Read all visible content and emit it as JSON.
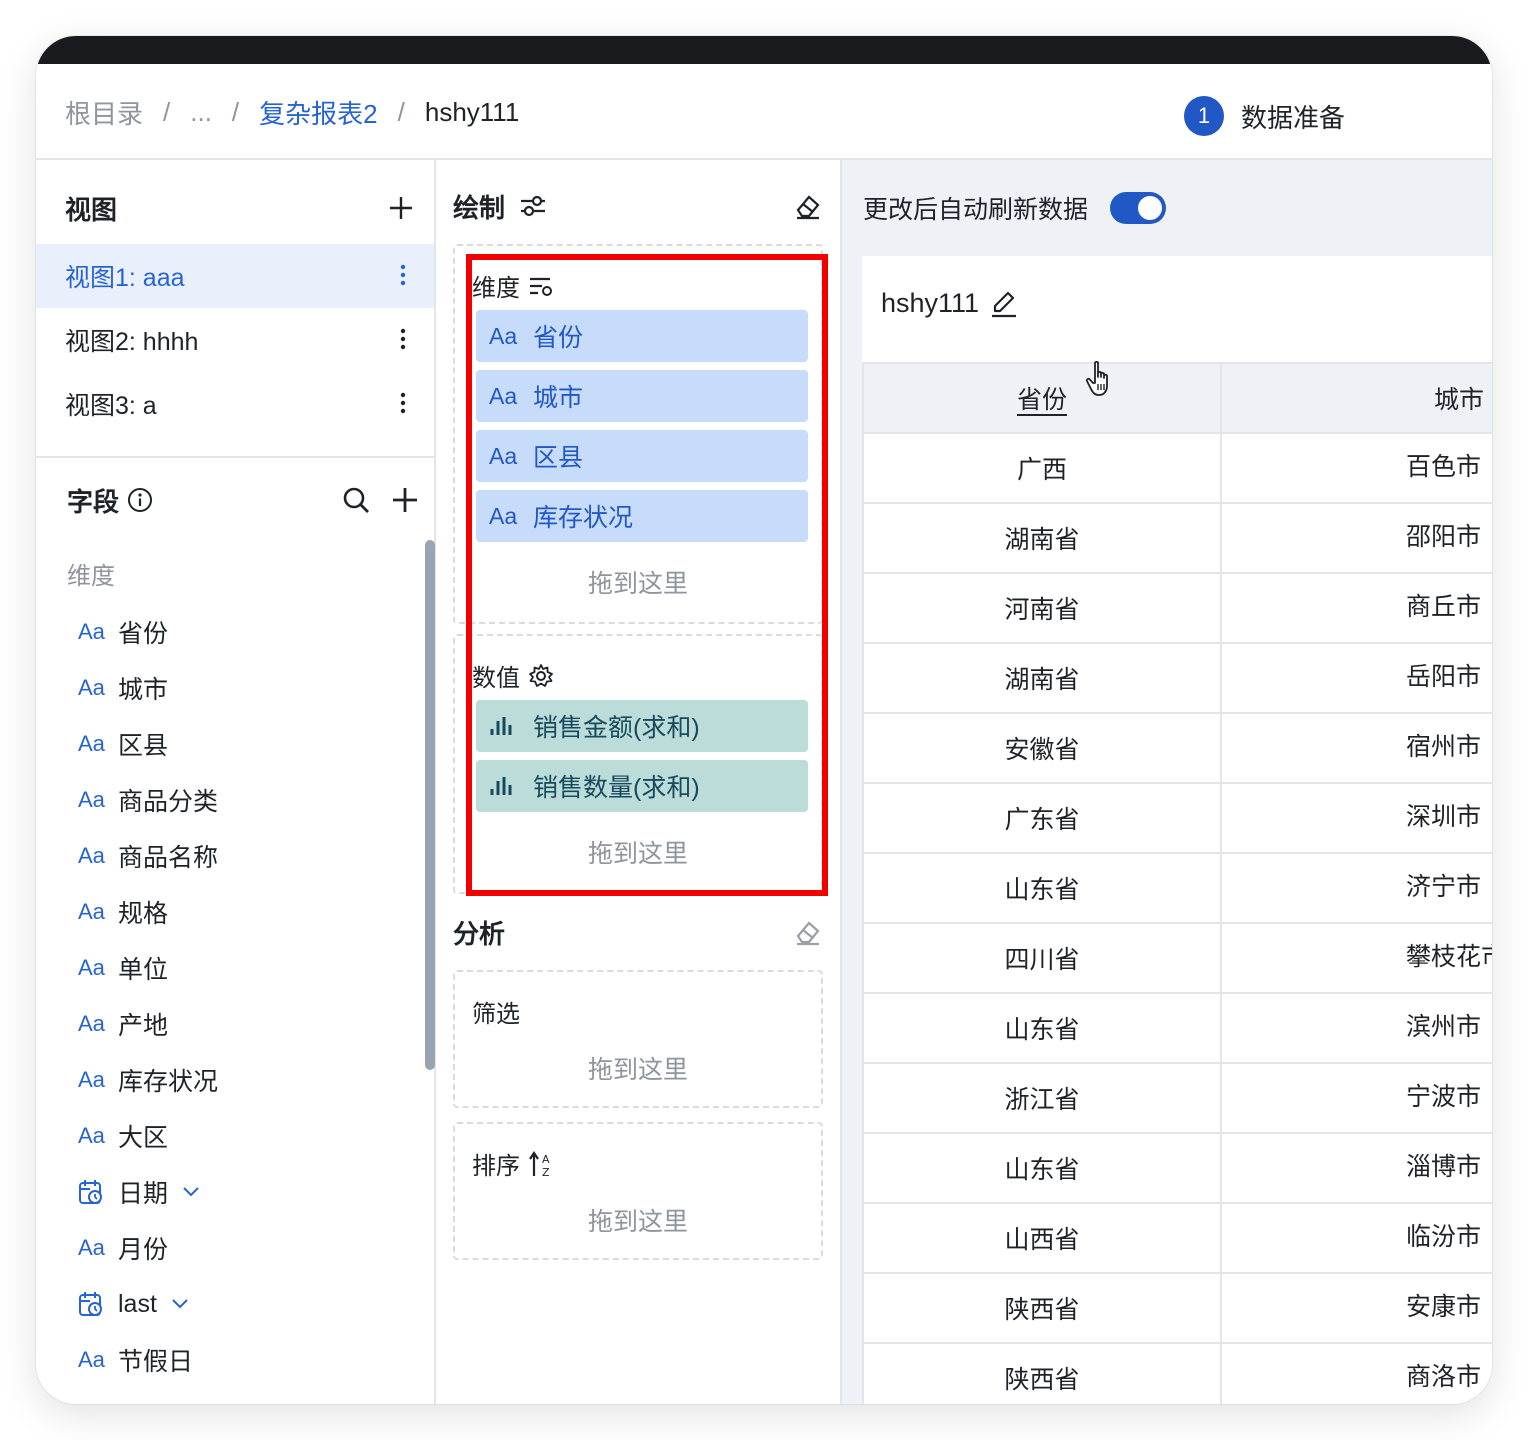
{
  "breadcrumb": {
    "root": "根目录",
    "ellipsis": "...",
    "parent": "复杂报表2",
    "current": "hshy111",
    "separator": "/"
  },
  "step": {
    "number": "1",
    "label": "数据准备"
  },
  "views": {
    "title": "视图",
    "add_icon": "plus-icon",
    "items": [
      {
        "label": "视图1: aaa",
        "active": true
      },
      {
        "label": "视图2: hhhh",
        "active": false
      },
      {
        "label": "视图3: a",
        "active": false
      }
    ]
  },
  "fields": {
    "title": "字段",
    "section_dimension": "维度",
    "type_text_glyph": "Aa",
    "items": [
      {
        "label": "省份",
        "type": "text"
      },
      {
        "label": "城市",
        "type": "text"
      },
      {
        "label": "区县",
        "type": "text"
      },
      {
        "label": "商品分类",
        "type": "text"
      },
      {
        "label": "商品名称",
        "type": "text"
      },
      {
        "label": "规格",
        "type": "text"
      },
      {
        "label": "单位",
        "type": "text"
      },
      {
        "label": "产地",
        "type": "text"
      },
      {
        "label": "库存状况",
        "type": "text"
      },
      {
        "label": "大区",
        "type": "text"
      },
      {
        "label": "日期",
        "type": "date"
      },
      {
        "label": "月份",
        "type": "text"
      },
      {
        "label": "last",
        "type": "date"
      },
      {
        "label": "节假日",
        "type": "text"
      }
    ]
  },
  "draw": {
    "title": "绘制",
    "dimension_label": "维度",
    "dimension_pills": [
      "省份",
      "城市",
      "区县",
      "库存状况"
    ],
    "measure_label": "数值",
    "measure_pills": [
      "销售金额(求和)",
      "销售数量(求和)"
    ],
    "drop_hint": "拖到这里"
  },
  "analysis": {
    "title": "分析",
    "filter_label": "筛选",
    "sort_label": "排序",
    "drop_hint": "拖到这里"
  },
  "preview": {
    "auto_refresh_label": "更改后自动刷新数据",
    "auto_refresh_on": true,
    "title": "hshy111",
    "columns": [
      "省份",
      "城市"
    ],
    "rows": [
      [
        "广西",
        "百色市"
      ],
      [
        "湖南省",
        "邵阳市"
      ],
      [
        "河南省",
        "商丘市"
      ],
      [
        "湖南省",
        "岳阳市"
      ],
      [
        "安徽省",
        "宿州市"
      ],
      [
        "广东省",
        "深圳市"
      ],
      [
        "山东省",
        "济宁市"
      ],
      [
        "四川省",
        "攀枝花市"
      ],
      [
        "山东省",
        "滨州市"
      ],
      [
        "浙江省",
        "宁波市"
      ],
      [
        "山东省",
        "淄博市"
      ],
      [
        "山西省",
        "临汾市"
      ],
      [
        "陕西省",
        "安康市"
      ],
      [
        "陕西省",
        "商洛市"
      ]
    ]
  },
  "colors": {
    "accent": "#2158c5",
    "highlight_frame": "#f20000",
    "dimension_pill": "#c7dbfb",
    "measure_pill": "#bcdcd9"
  }
}
